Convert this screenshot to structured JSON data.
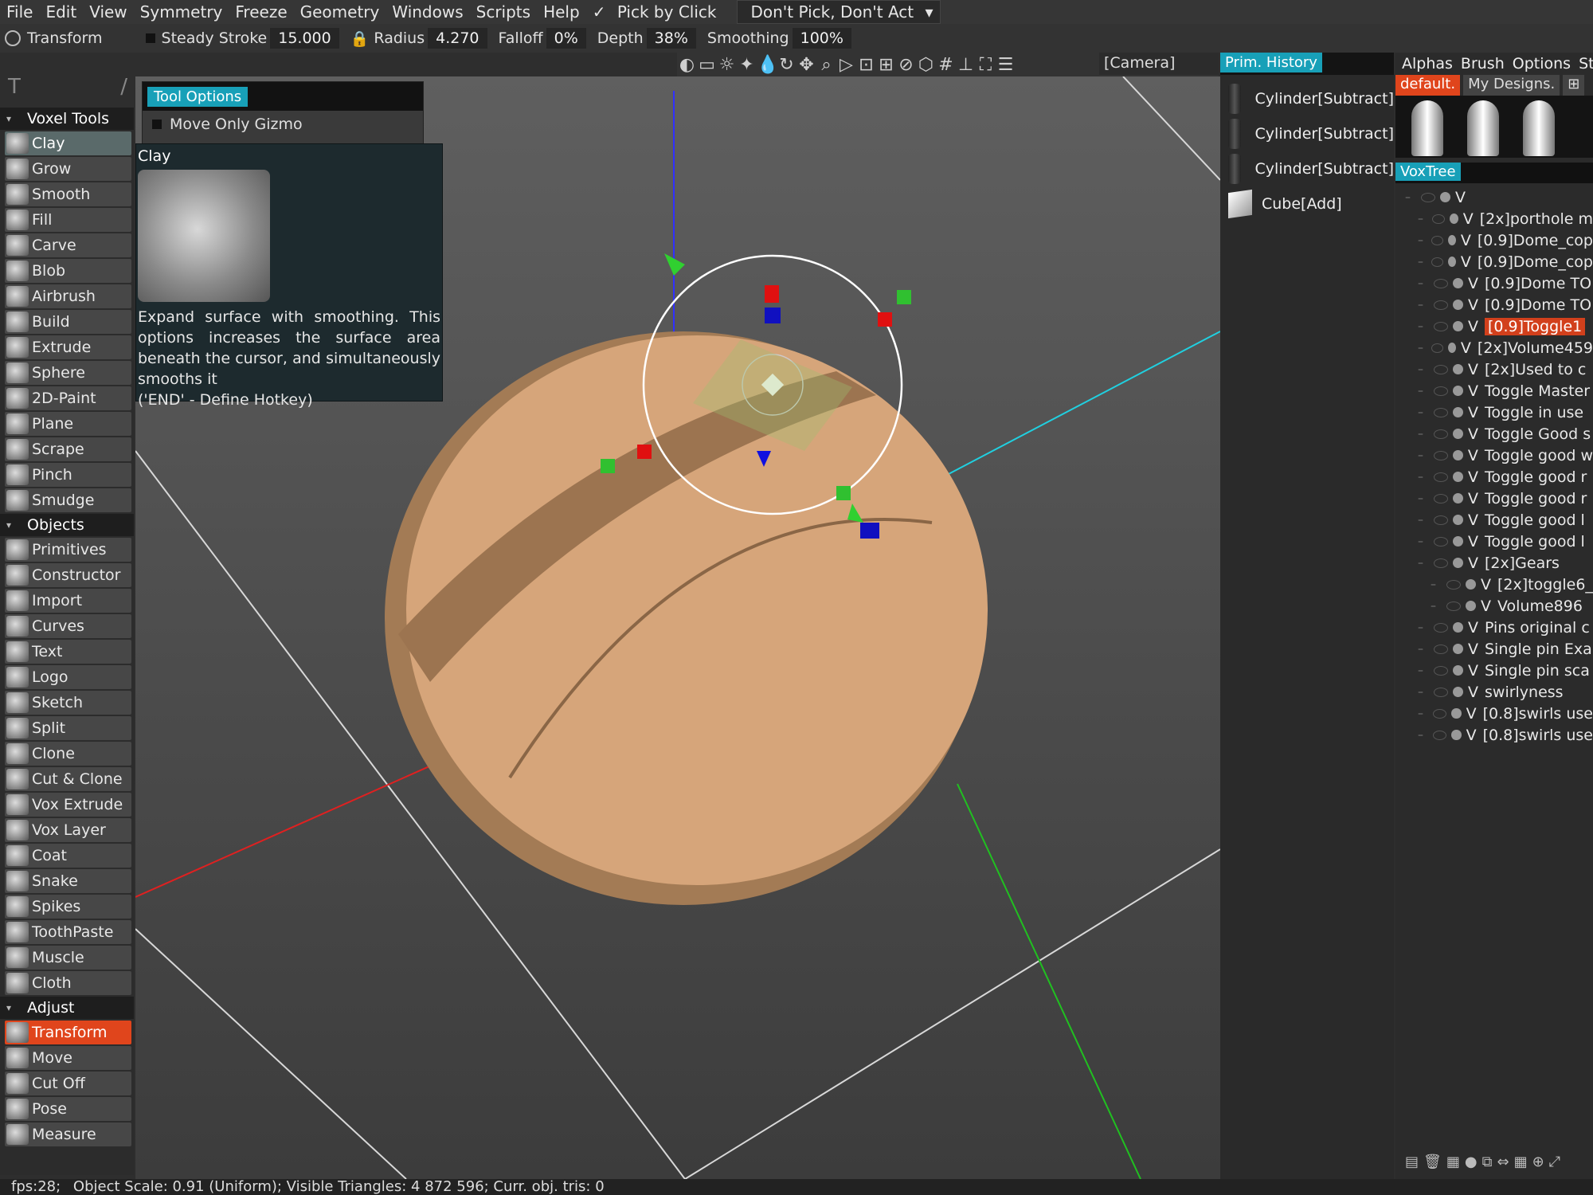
{
  "menu": {
    "items": [
      "File",
      "Edit",
      "View",
      "Symmetry",
      "Freeze",
      "Geometry",
      "Windows",
      "Scripts",
      "Help"
    ],
    "pick_by_click": "Pick by Click",
    "pick_mode": "Don't Pick, Don't Act"
  },
  "toolbar": {
    "mode": "Transform",
    "steady_stroke_label": "Steady Stroke",
    "steady_stroke_value": "15.000",
    "radius_label": "Radius",
    "radius_value": "4.270",
    "falloff_label": "Falloff",
    "falloff_value": "0%",
    "depth_label": "Depth",
    "depth_value": "38%",
    "smoothing_label": "Smoothing",
    "smoothing_value": "100%",
    "camera": "[Camera]"
  },
  "left_panel": {
    "sections": [
      {
        "title": "Voxel Tools",
        "items": [
          "Clay",
          "Grow",
          "Smooth",
          "Fill",
          "Carve",
          "Blob",
          "Airbrush",
          "Build",
          "Extrude",
          "Sphere",
          "2D-Paint",
          "Plane",
          "Scrape",
          "Pinch",
          "Smudge"
        ]
      },
      {
        "title": "Objects",
        "items": [
          "Primitives",
          "Constructor",
          "Import",
          "Curves",
          "Text",
          "Logo",
          "Sketch",
          "Split",
          "Clone",
          "Cut & Clone",
          "Vox Extrude",
          "Vox Layer",
          "Coat",
          "Snake",
          "Spikes",
          "ToothPaste",
          "Muscle",
          "Cloth"
        ]
      },
      {
        "title": "Adjust",
        "items": [
          "Transform",
          "Move",
          "Cut Off",
          "Pose",
          "Measure"
        ]
      }
    ]
  },
  "tool_options": {
    "tab": "Tool Options",
    "option": "Move Only Gizmo"
  },
  "tooltip": {
    "title": "Clay",
    "description": "Expand surface with smoothing. This options increases the surface area beneath the cursor, and simultaneously smooths it",
    "hotkey": "('END' - Define Hotkey)"
  },
  "history": {
    "tab": "Prim. History",
    "items": [
      "Cylinder[Subtract]",
      "Cylinder[Subtract]",
      "Cylinder[Subtract]",
      "Cube[Add]"
    ]
  },
  "right_panel": {
    "tabs": [
      "Alphas",
      "Brush",
      "Options",
      "Stri"
    ],
    "alpha_tabs": [
      "default.",
      "My Designs."
    ],
    "voxtree_tab": "VoxTree",
    "tree": [
      {
        "label": "V",
        "name": ""
      },
      {
        "label": "V",
        "name": "[2x]porthole m"
      },
      {
        "label": "V",
        "name": "[0.9]Dome_cop"
      },
      {
        "label": "V",
        "name": "[0.9]Dome_cop"
      },
      {
        "label": "V",
        "name": "[0.9]Dome TO"
      },
      {
        "label": "V",
        "name": "[0.9]Dome TO"
      },
      {
        "label": "V",
        "name": "[0.9]Toggle1"
      },
      {
        "label": "V",
        "name": "[2x]Volume459"
      },
      {
        "label": "V",
        "name": "[2x]Used to c"
      },
      {
        "label": "V",
        "name": "Toggle Master"
      },
      {
        "label": "V",
        "name": "Toggle in use"
      },
      {
        "label": "V",
        "name": "Toggle Good s"
      },
      {
        "label": "V",
        "name": "Toggle good w"
      },
      {
        "label": "V",
        "name": "Toggle good r"
      },
      {
        "label": "V",
        "name": "Toggle good r"
      },
      {
        "label": "V",
        "name": "Toggle good l"
      },
      {
        "label": "V",
        "name": "Toggle good l"
      },
      {
        "label": "V",
        "name": "[2x]Gears"
      },
      {
        "label": "V",
        "name": "[2x]toggle6_"
      },
      {
        "label": "V",
        "name": "Volume896"
      },
      {
        "label": "V",
        "name": "Pins original c"
      },
      {
        "label": "V",
        "name": "Single pin Exa"
      },
      {
        "label": "V",
        "name": "Single pin sca"
      },
      {
        "label": "V",
        "name": "swirlyness"
      },
      {
        "label": "V",
        "name": "[0.8]swirls use"
      },
      {
        "label": "V",
        "name": "[0.8]swirls use"
      }
    ]
  },
  "status": {
    "fps": "fps:28;",
    "info": "Object Scale: 0.91 (Uniform); Visible Triangles: 4 872 596; Curr. obj. tris: 0"
  },
  "colors": {
    "accent": "#18a0b8",
    "active": "#e0451c",
    "object": "#d6a57a"
  }
}
